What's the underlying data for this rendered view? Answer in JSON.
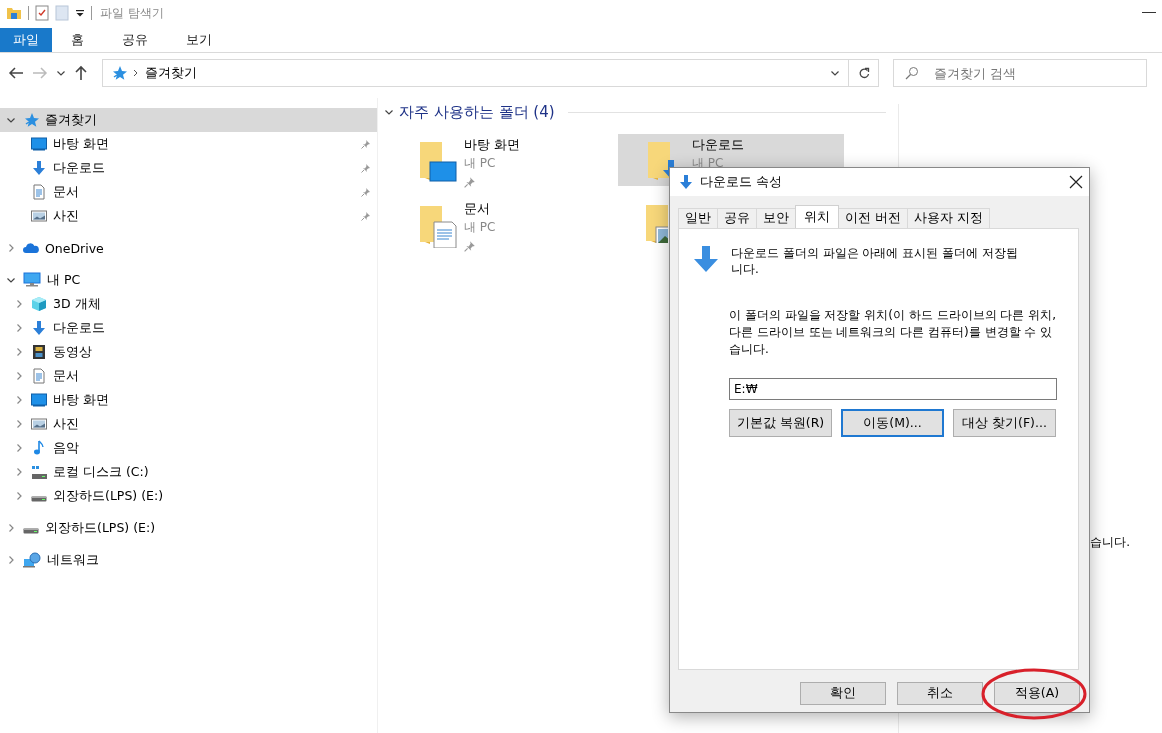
{
  "window": {
    "title": "파일 탐색기"
  },
  "ribbon_tabs": [
    {
      "label": "파일",
      "selected": true
    },
    {
      "label": "홈",
      "selected": false
    },
    {
      "label": "공유",
      "selected": false
    },
    {
      "label": "보기",
      "selected": false
    }
  ],
  "address_bar": {
    "path": "즐겨찾기"
  },
  "search": {
    "placeholder": "즐겨찾기 검색"
  },
  "nav_tree": [
    {
      "label": "즐겨찾기",
      "kind": "star",
      "expanded": true,
      "selected": true,
      "children": [
        {
          "label": "바탕 화면",
          "kind": "desktop",
          "pinned": true,
          "selected": false
        },
        {
          "label": "다운로드",
          "kind": "download",
          "pinned": true,
          "selected": false
        },
        {
          "label": "문서",
          "kind": "document",
          "pinned": true,
          "selected": false
        },
        {
          "label": "사진",
          "kind": "pictures",
          "pinned": true,
          "selected": false
        }
      ]
    },
    {
      "label": "OneDrive",
      "kind": "cloud",
      "expanded": false,
      "selected": false
    },
    {
      "label": "내 PC",
      "kind": "pc",
      "expanded": true,
      "selected": false,
      "children": [
        {
          "label": "3D 개체",
          "kind": "cube",
          "expanded": false,
          "selected": false
        },
        {
          "label": "다운로드",
          "kind": "download",
          "expanded": false,
          "selected": false
        },
        {
          "label": "동영상",
          "kind": "video",
          "expanded": false,
          "selected": false
        },
        {
          "label": "문서",
          "kind": "document",
          "expanded": false,
          "selected": false
        },
        {
          "label": "바탕 화면",
          "kind": "desktop",
          "expanded": false,
          "selected": false
        },
        {
          "label": "사진",
          "kind": "pictures",
          "expanded": false,
          "selected": false
        },
        {
          "label": "음악",
          "kind": "music",
          "expanded": false,
          "selected": false
        },
        {
          "label": "로컬 디스크 (C:)",
          "kind": "system",
          "expanded": false,
          "selected": false
        },
        {
          "label": "외장하드(LPS) (E:)",
          "kind": "drive",
          "expanded": false,
          "selected": false
        }
      ]
    },
    {
      "label": "외장하드(LPS) (E:)",
      "kind": "drive",
      "expanded": false,
      "selected": false
    },
    {
      "label": "네트워크",
      "kind": "network",
      "expanded": false,
      "selected": false
    }
  ],
  "frequent_folders": {
    "title": "자주 사용하는 폴더 (4)",
    "expanded": true,
    "folders": [
      {
        "name": "바탕 화면",
        "location": "내 PC",
        "kind": "desktop",
        "pinned": true,
        "selected": false
      },
      {
        "name": "다운로드",
        "location": "내 PC",
        "kind": "download",
        "selected": true
      },
      {
        "name": "문서",
        "location": "내 PC",
        "kind": "document",
        "pinned": true,
        "selected": false
      },
      {
        "kind": "pictures",
        "selected": false
      }
    ]
  },
  "details_pane": {
    "message": "습니다."
  },
  "dialog": {
    "title": "다운로드 속성",
    "tabs": [
      {
        "label": "일반",
        "selected": false
      },
      {
        "label": "공유",
        "selected": false
      },
      {
        "label": "보안",
        "selected": false
      },
      {
        "label": "위치",
        "selected": true
      },
      {
        "label": "이전 버전",
        "selected": false
      },
      {
        "label": "사용자 지정",
        "selected": false
      }
    ],
    "description": "다운로드 폴더의 파일은 아래에 표시된 폴더에 저장됩니다.",
    "info": "이 폴더의 파일을 저장할 위치(이 하드 드라이브의 다른 위치, 다른 드라이브 또는 네트워크의 다른 컴퓨터)를 변경할 수 있습니다.",
    "path": "E:₩",
    "buttons": [
      {
        "label": "기본값 복원(R)",
        "focused": false
      },
      {
        "label": "이동(M)...",
        "focused": true
      },
      {
        "label": "대상 찾기(F)...",
        "focused": false
      }
    ],
    "footer_buttons": [
      {
        "label": "확인",
        "highlighted": false
      },
      {
        "label": "취소",
        "highlighted": false
      },
      {
        "label": "적용(A)",
        "highlighted": true
      }
    ]
  }
}
